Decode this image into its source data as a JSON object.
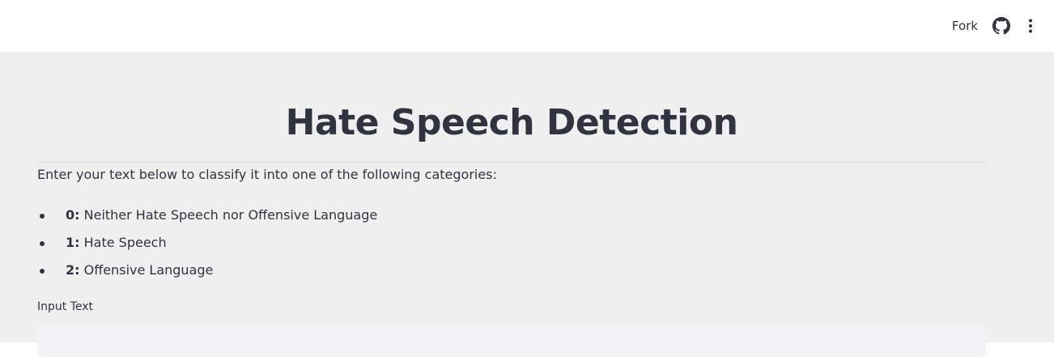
{
  "header": {
    "fork_label": "Fork",
    "github_icon": "github-icon",
    "menu_icon": "kebab-menu-icon"
  },
  "main": {
    "title": "Hate Speech Detection",
    "intro": "Enter your text below to classify it into one of the following categories:",
    "categories": [
      {
        "num": "0:",
        "label": "Neither Hate Speech nor Offensive Language"
      },
      {
        "num": "1:",
        "label": "Hate Speech"
      },
      {
        "num": "2:",
        "label": "Offensive Language"
      }
    ],
    "input_label": "Input Text",
    "input_value": ""
  },
  "colors": {
    "background": "#efefef",
    "header": "#ffffff",
    "text": "#31333f",
    "input_bg": "#f0f2f6"
  }
}
